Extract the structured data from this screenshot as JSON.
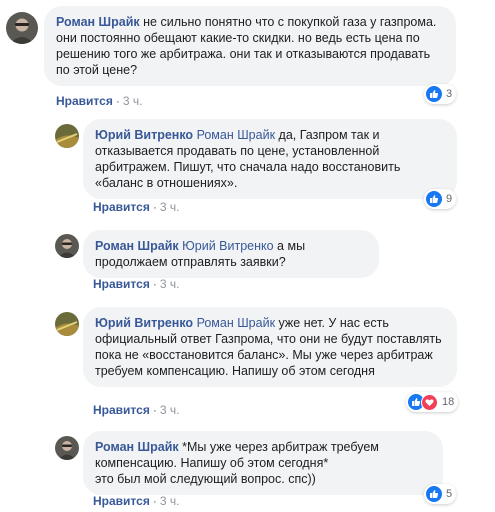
{
  "comments": [
    {
      "author": "Роман Шрайк",
      "mention": "",
      "text": " не сильно понятно что с покупкой газа у газпрома. они постоянно обещают какие-то скидки. но ведь есть цена по решению того же арбитража. они так и отказываются продавать по этой цене?",
      "like_label": "Нравится",
      "time": "3 ч.",
      "reaction_count": "3"
    },
    {
      "author": "Юрий Витренко",
      "mention": "Роман Шрайк",
      "text": " да, Газпром так и отказывается продавать по цене, установленной арбитражем. Пишут, что сначала надо восстановить «баланс в отношениях».",
      "like_label": "Нравится",
      "time": "3 ч.",
      "reaction_count": "9"
    },
    {
      "author": "Роман Шрайк",
      "mention": "Юрий Витренко",
      "text": " а мы продолжаем отправлять заявки?",
      "like_label": "Нравится",
      "time": "3 ч."
    },
    {
      "author": "Юрий Витренко",
      "mention": "Роман Шрайк",
      "text": " уже нет. У нас есть официальный ответ Газпрома, что они не будут поставлять пока не «восстановится баланс». Мы уже через арбитраж требуем компенсацию. Напишу об этом сегодня",
      "like_label": "Нравится",
      "time": "3 ч.",
      "reaction_count": "18"
    },
    {
      "author": "Роман Шрайк",
      "mention": "",
      "text": " *Мы уже через арбитраж требуем компенсацию. Напишу об этом сегодня*",
      "text2": "это был мой следующий вопрос. спс))",
      "like_label": "Нравится",
      "time": "3 ч.",
      "reaction_count": "5"
    }
  ],
  "separator": "·",
  "colors": {
    "link": "#385898",
    "bubble": "#f2f3f5",
    "like_blue": "#1877f2",
    "love_red": "#f33e58"
  },
  "icons": {
    "like": "thumbs-up-icon",
    "love": "heart-icon"
  }
}
